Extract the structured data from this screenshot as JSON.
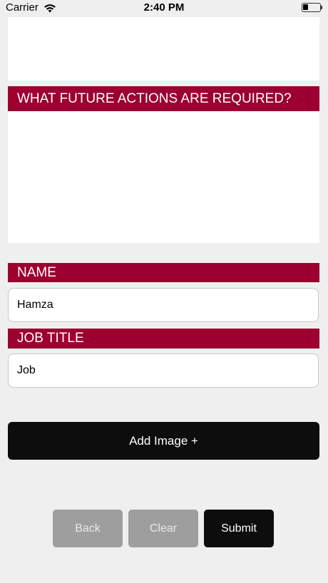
{
  "status_bar": {
    "carrier": "Carrier",
    "time": "2:40 PM",
    "battery_level": 0.3,
    "wifi_icon": "wifi-icon",
    "battery_icon": "battery-icon"
  },
  "form": {
    "future_actions_header": "WHAT FUTURE ACTIONS ARE REQUIRED?",
    "name_header": "NAME",
    "name_value": "Hamza",
    "job_title_header": "JOB TITLE",
    "job_title_value": "Job"
  },
  "actions": {
    "add_image_label": "Add Image +",
    "back_label": "Back",
    "clear_label": "Clear",
    "submit_label": "Submit"
  },
  "colors": {
    "header_bg": "#9b0030",
    "primary_button": "#0d0d0d",
    "disabled_button": "#9e9e9e",
    "page_bg": "#efefef"
  }
}
